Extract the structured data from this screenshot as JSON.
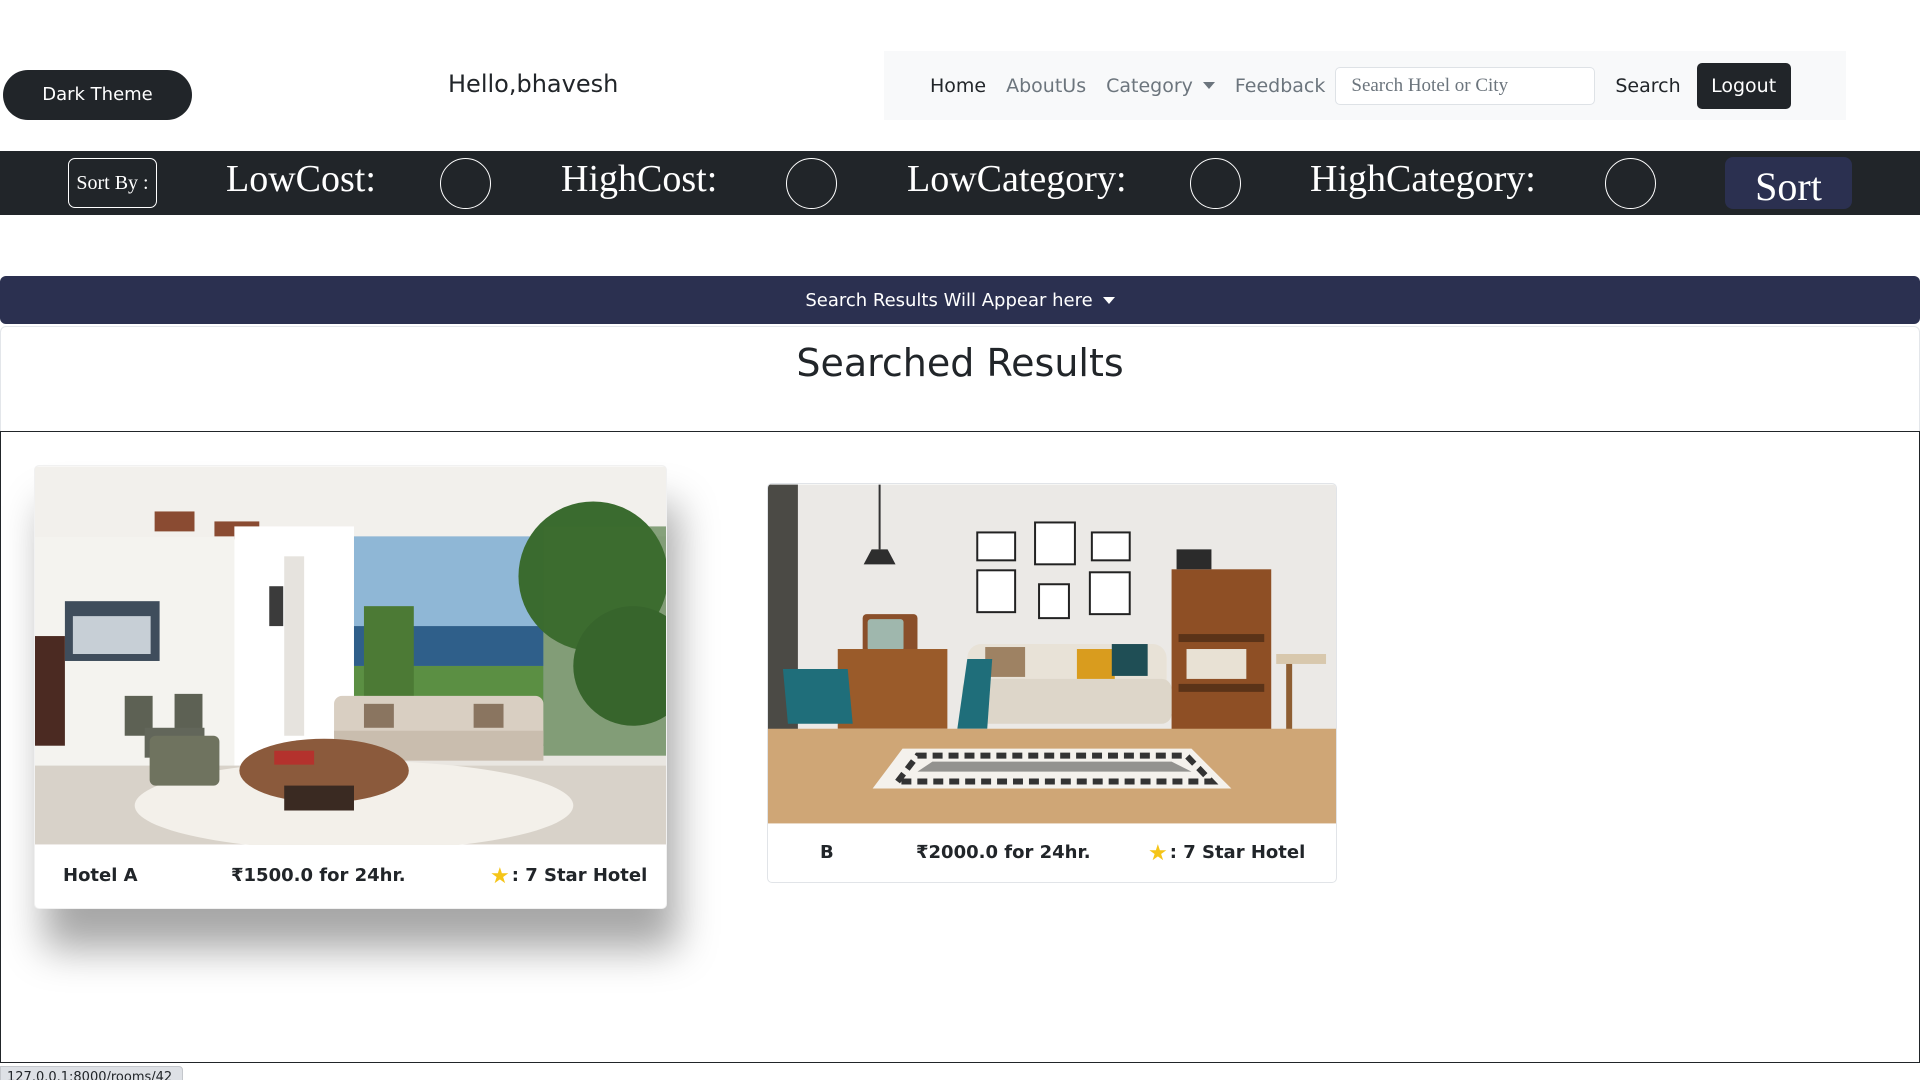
{
  "header": {
    "theme_button": "Dark Theme",
    "greeting": "Hello,bhavesh"
  },
  "nav": {
    "home": "Home",
    "about": "AboutUs",
    "category": "Category",
    "feedback": "Feedback",
    "search_placeholder": "Search Hotel or City",
    "search_button": "Search",
    "logout_button": "Logout"
  },
  "sortbar": {
    "sort_by": "Sort By :",
    "options": [
      "LowCost:",
      "HighCost:",
      "LowCategory:",
      "HighCategory:"
    ],
    "sort_button": "Sort"
  },
  "results": {
    "collapse_label": "Search Results Will Appear here",
    "title": "Searched Results"
  },
  "hotels": [
    {
      "name": "Hotel A",
      "price": "₹1500.0 for 24hr.",
      "rating": ": 7 Star Hotel"
    },
    {
      "name": "B",
      "price": "₹2000.0 for 24hr.",
      "rating": ": 7 Star Hotel"
    }
  ],
  "status_url": "127.0.0.1:8000/rooms/42",
  "colors": {
    "dark": "#212529",
    "navy": "#2b3050",
    "star": "#f5c518",
    "navbar_bg": "#f8f9fa"
  }
}
